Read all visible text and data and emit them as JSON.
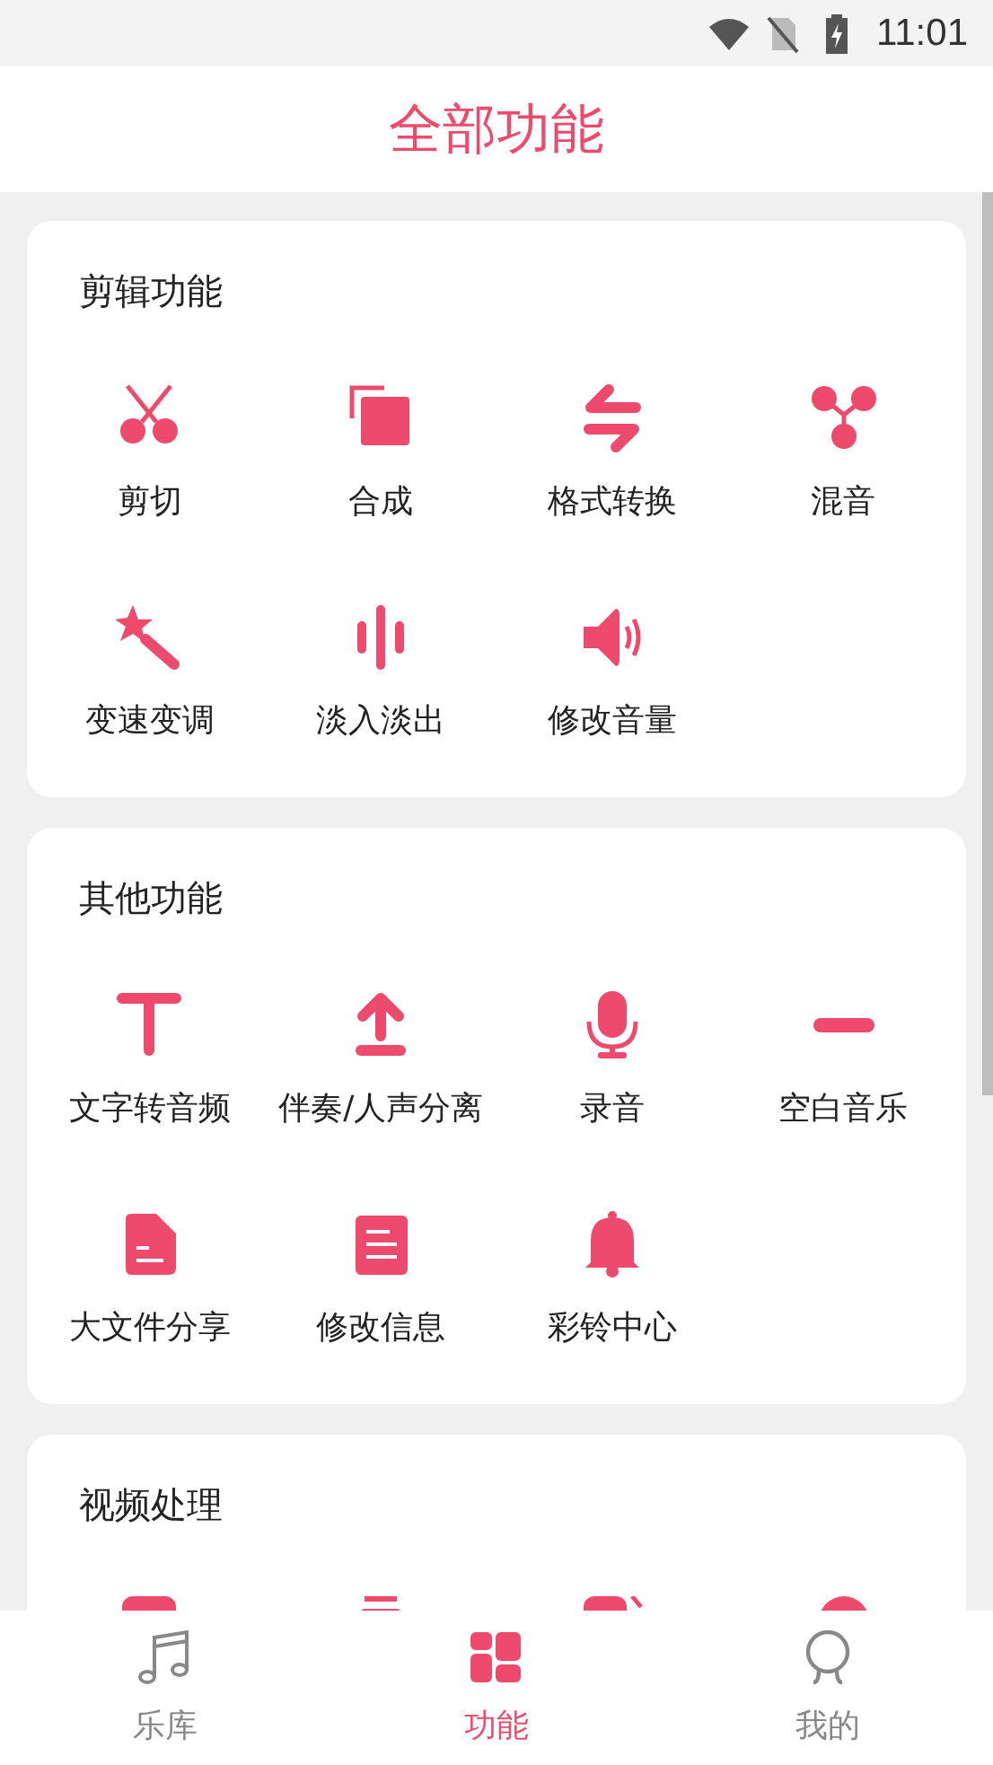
{
  "status_bar": {
    "time": "11:01"
  },
  "header": {
    "title": "全部功能"
  },
  "sections": [
    {
      "title": "剪辑功能",
      "items": [
        {
          "label": "剪切"
        },
        {
          "label": "合成"
        },
        {
          "label": "格式转换"
        },
        {
          "label": "混音"
        },
        {
          "label": "变速变调"
        },
        {
          "label": "淡入淡出"
        },
        {
          "label": "修改音量"
        }
      ]
    },
    {
      "title": "其他功能",
      "items": [
        {
          "label": "文字转音频"
        },
        {
          "label": "伴奏/人声分离"
        },
        {
          "label": "录音"
        },
        {
          "label": "空白音乐"
        },
        {
          "label": "大文件分享"
        },
        {
          "label": "修改信息"
        },
        {
          "label": "彩铃中心"
        }
      ]
    },
    {
      "title": "视频处理"
    }
  ],
  "tabs": [
    {
      "label": "乐库",
      "selected": false
    },
    {
      "label": "功能",
      "selected": true
    },
    {
      "label": "我的",
      "selected": false
    }
  ]
}
